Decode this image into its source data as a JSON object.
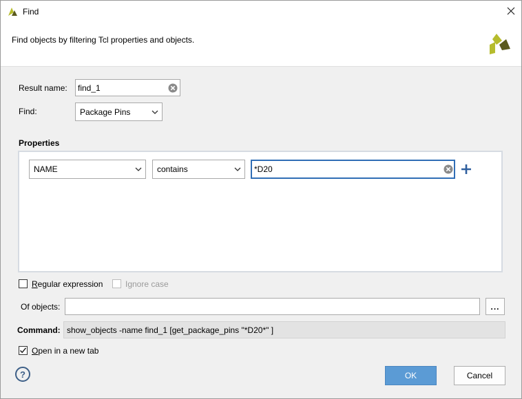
{
  "window": {
    "title": "Find"
  },
  "description": "Find objects by filtering Tcl properties and objects.",
  "result_name": {
    "label": "Result name:",
    "value": "find_1"
  },
  "find": {
    "label": "Find:",
    "value": "Package Pins"
  },
  "properties": {
    "heading": "Properties",
    "rows": [
      {
        "property": "NAME",
        "operator": "contains",
        "value": "*D20"
      }
    ]
  },
  "regular_expression": {
    "label": "Regular expression",
    "checked": false
  },
  "ignore_case": {
    "label": "Ignore case",
    "checked": false,
    "disabled": true
  },
  "of_objects": {
    "label": "Of objects:",
    "value": "",
    "browse_label": "..."
  },
  "command": {
    "label": "Command:",
    "value": "show_objects -name find_1 [get_package_pins \"*D20*\" ]"
  },
  "open_new_tab": {
    "label": "Open in a new tab",
    "checked": true
  },
  "buttons": {
    "help": "?",
    "ok": "OK",
    "cancel": "Cancel"
  },
  "colors": {
    "accent": "#5b9bd5",
    "logo_dark": "#5a5a1e",
    "logo_light": "#b6bc2d"
  }
}
